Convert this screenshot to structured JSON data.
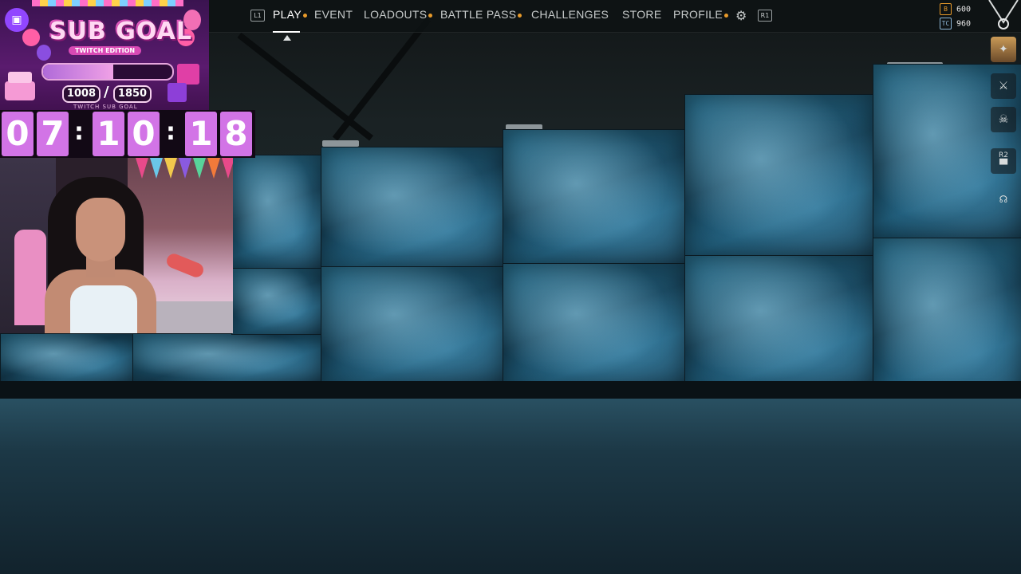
{
  "nav": {
    "l1": "L1",
    "r1": "R1",
    "items": [
      {
        "label": "PLAY",
        "active": true,
        "dot": true
      },
      {
        "label": "EVENT",
        "active": false,
        "dot": false
      },
      {
        "label": "LOADOUTS",
        "active": false,
        "dot": true
      },
      {
        "label": "BATTLE PASS",
        "active": false,
        "dot": true
      },
      {
        "label": "CHALLENGES",
        "active": false,
        "dot": false
      },
      {
        "label": "STORE",
        "active": false,
        "dot": false
      },
      {
        "label": "PROFILE",
        "active": false,
        "dot": true
      }
    ],
    "settings_icon": "gear-icon"
  },
  "currency": {
    "points": {
      "icon_label": "B",
      "value": "600",
      "color": "#e89a2a"
    },
    "tokens": {
      "icon_label": "TC",
      "value": "960",
      "color": "#8fb8d8"
    }
  },
  "side_icons": [
    "emblem-icon",
    "weapon-icon",
    "skull-icon",
    "chat-icon",
    "social-icon"
  ],
  "side_hint": "R2",
  "overlay": {
    "goal_title": "SUB GOAL",
    "goal_subtitle": "TWITCH EDITION",
    "current": "1008",
    "target": "1850",
    "progress_fraction": 0.545,
    "footer": "TWITCH SUB GOAL",
    "timer": {
      "hh": [
        "0",
        "7"
      ],
      "mm": [
        "1",
        "0"
      ],
      "ss": [
        "1",
        "8"
      ]
    }
  }
}
